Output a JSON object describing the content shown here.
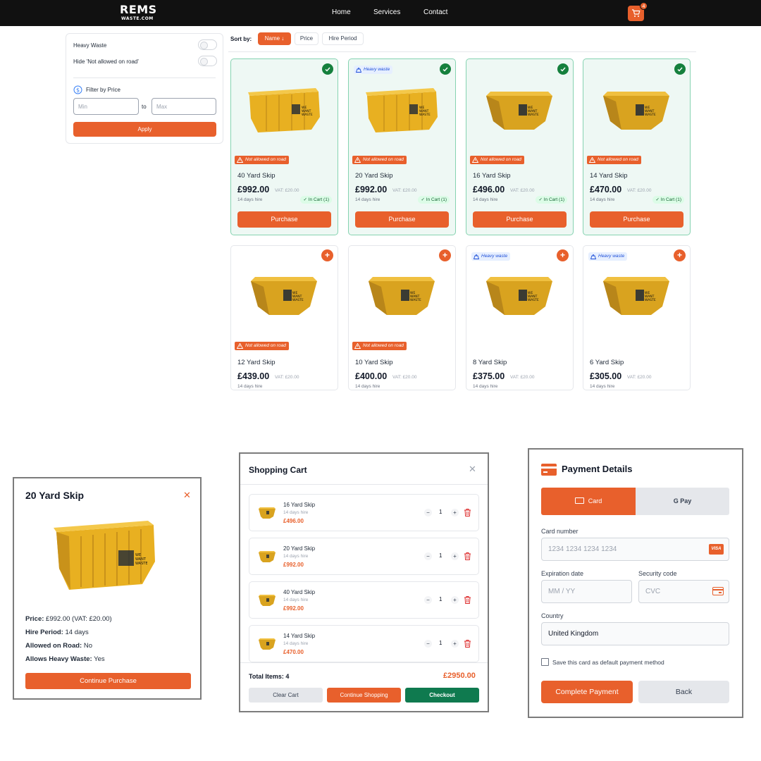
{
  "nav": {
    "logo_line1": "REMS",
    "logo_line2": "WASTE.COM",
    "links": [
      "Home",
      "Services",
      "Contact"
    ],
    "cart_count": "4"
  },
  "filters": {
    "heavy_waste_label": "Heavy Waste",
    "hide_not_allowed_label": "Hide 'Not allowed on road'",
    "price_heading": "Filter by Price",
    "min_placeholder": "Min",
    "to_label": "to",
    "max_placeholder": "Max",
    "apply_label": "Apply"
  },
  "sort": {
    "label": "Sort by:",
    "options": [
      "Name ↓",
      "Price",
      "Hire Period"
    ],
    "active": "Name ↓"
  },
  "cards": [
    {
      "name": "40 Yard Skip",
      "price": "£992.00",
      "vat": "VAT: £20.00",
      "hire": "14 days hire",
      "selected": true,
      "heavy": false,
      "not_allowed": true,
      "in_cart": "In Cart (1)",
      "button": "Purchase"
    },
    {
      "name": "20 Yard Skip",
      "price": "£992.00",
      "vat": "VAT: £20.00",
      "hire": "14 days hire",
      "selected": true,
      "heavy": true,
      "not_allowed": true,
      "in_cart": "In Cart (1)",
      "button": "Purchase"
    },
    {
      "name": "16 Yard Skip",
      "price": "£496.00",
      "vat": "VAT: £20.00",
      "hire": "14 days hire",
      "selected": true,
      "heavy": false,
      "not_allowed": true,
      "in_cart": "In Cart (1)",
      "button": "Purchase"
    },
    {
      "name": "14 Yard Skip",
      "price": "£470.00",
      "vat": "VAT: £20.00",
      "hire": "14 days hire",
      "selected": true,
      "heavy": false,
      "not_allowed": true,
      "in_cart": "In Cart (1)",
      "button": "Purchase"
    },
    {
      "name": "12 Yard Skip",
      "price": "£439.00",
      "vat": "VAT: £20.00",
      "hire": "14 days hire",
      "selected": false,
      "heavy": false,
      "not_allowed": true
    },
    {
      "name": "10 Yard Skip",
      "price": "£400.00",
      "vat": "VAT: £20.00",
      "hire": "14 days hire",
      "selected": false,
      "heavy": false,
      "not_allowed": true
    },
    {
      "name": "8 Yard Skip",
      "price": "£375.00",
      "vat": "VAT: £20.00",
      "hire": "14 days hire",
      "selected": false,
      "heavy": true,
      "not_allowed": false
    },
    {
      "name": "6 Yard Skip",
      "price": "£305.00",
      "vat": "VAT: £20.00",
      "hire": "14 days hire",
      "selected": false,
      "heavy": true,
      "not_allowed": false
    }
  ],
  "badges": {
    "heavy": "Heavy waste",
    "not_allowed": "Not allowed on road",
    "skip_brand": "WE WANT WASTE"
  },
  "detail_modal": {
    "title": "20 Yard Skip",
    "price_label": "Price:",
    "price_value": "£992.00 (VAT: £20.00)",
    "hire_label": "Hire Period:",
    "hire_value": "14 days",
    "road_label": "Allowed on Road:",
    "road_value": "No",
    "heavy_label": "Allows Heavy Waste:",
    "heavy_value": "Yes",
    "button": "Continue Purchase"
  },
  "cart_modal": {
    "title": "Shopping Cart",
    "items": [
      {
        "name": "16 Yard Skip",
        "hire": "14 days hire",
        "price": "£496.00",
        "qty": "1"
      },
      {
        "name": "20 Yard Skip",
        "hire": "14 days hire",
        "price": "£992.00",
        "qty": "1"
      },
      {
        "name": "40 Yard Skip",
        "hire": "14 days hire",
        "price": "£992.00",
        "qty": "1"
      },
      {
        "name": "14 Yard Skip",
        "hire": "14 days hire",
        "price": "£470.00",
        "qty": "1"
      }
    ],
    "total_items": "Total Items: 4",
    "total_price": "£2950.00",
    "clear": "Clear Cart",
    "continue": "Continue Shopping",
    "checkout": "Checkout"
  },
  "payment_modal": {
    "title": "Payment Details",
    "tab_card": "Card",
    "tab_gpay": "G Pay",
    "card_number_label": "Card number",
    "card_number_placeholder": "1234 1234 1234 1234",
    "visa": "VISA",
    "expiry_label": "Expiration date",
    "expiry_placeholder": "MM / YY",
    "cvc_label": "Security code",
    "cvc_placeholder": "CVC",
    "country_label": "Country",
    "country_value": "United Kingdom",
    "save_label": "Save this card as default payment method",
    "complete": "Complete Payment",
    "back": "Back"
  },
  "colors": {
    "accent": "#e8602c",
    "success": "#15803d",
    "checkout": "#0f7a4f",
    "skip": "#e8b021"
  }
}
